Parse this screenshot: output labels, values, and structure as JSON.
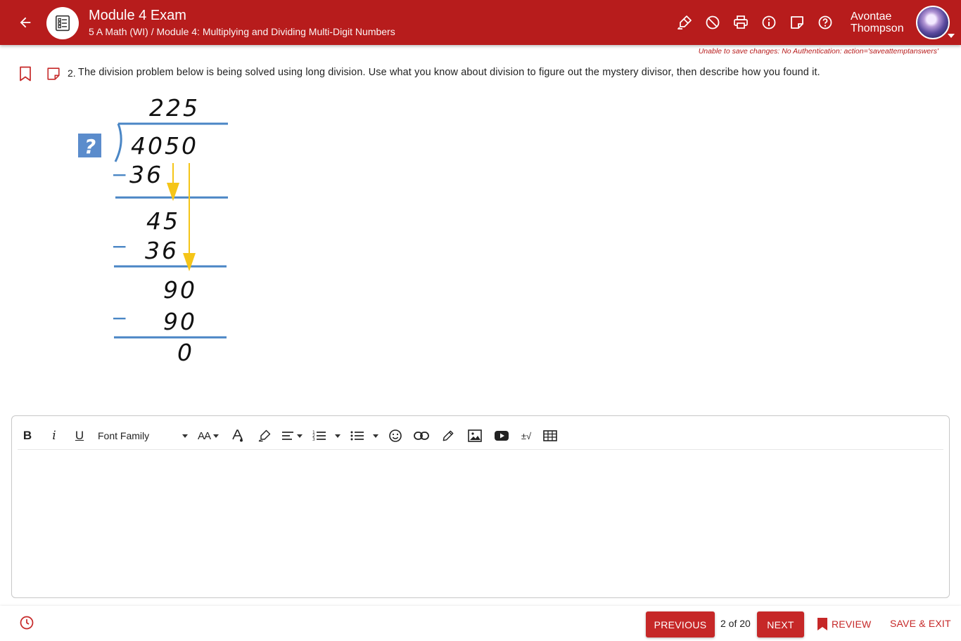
{
  "header": {
    "title": "Module 4 Exam",
    "breadcrumb": "5 A Math (WI) / Module 4: Multiplying and Dividing Multi-Digit Numbers",
    "user_first": "Avontae",
    "user_last": "Thompson",
    "tools": [
      "highlighter-icon",
      "eliminator-icon",
      "print-icon",
      "info-icon",
      "note-icon",
      "help-icon"
    ]
  },
  "status": {
    "save_error": "Unable to save changes: No Authentication: action='saveattemptanswers'"
  },
  "question": {
    "number": "2.",
    "text": "The division problem below is being solved using long division. Use what you know about division to figure out the mystery divisor, then describe how you found it.",
    "figure": {
      "quotient": "225",
      "unknown_divisor": "?",
      "dividend": "4050",
      "step1_subtract": "36",
      "step1_minus": "−",
      "step2_partial": "45",
      "step2_subtract": "36",
      "step2_minus": "−",
      "step3_partial": "90",
      "step3_subtract": "90",
      "step3_minus": "−",
      "remainder": "0",
      "colors": {
        "line": "#4a86c5",
        "arrow": "#f5c518",
        "divisor_box": "#5b8ccc"
      }
    }
  },
  "editor": {
    "bold": "B",
    "italic": "i",
    "underline": "U",
    "font_family": "Font Family",
    "font_size": "AA",
    "equation": "±√"
  },
  "footer": {
    "previous": "PREVIOUS",
    "page": "2 of 20",
    "next": "NEXT",
    "review": "REVIEW",
    "save_exit": "SAVE & EXIT"
  },
  "colors": {
    "brand": "#b71c1c",
    "button": "#c62828"
  }
}
